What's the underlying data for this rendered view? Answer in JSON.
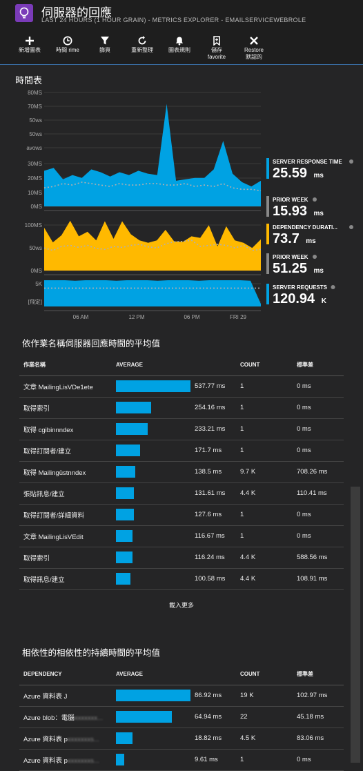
{
  "header": {
    "title": "伺服器的回應",
    "subtitle": "LAST 24 HOURS (1 HOUR GRAIN) - METRICS EXPLORER - EMAILSERVICEWEBROLE"
  },
  "toolbar": {
    "items": [
      {
        "label": "新增圖表",
        "icon": "plus-icon"
      },
      {
        "label": "時間 rime",
        "icon": "clock-icon"
      },
      {
        "label": "篩頁",
        "icon": "filter-icon"
      },
      {
        "label": "重新整理",
        "icon": "refresh-icon"
      },
      {
        "label": "圖表規則",
        "icon": "bell-icon"
      },
      {
        "label1": "儲存",
        "label2": "favorite",
        "icon": "bookmark-icon"
      },
      {
        "label1": "Restore",
        "label2": "默認的",
        "icon": "close-icon"
      }
    ]
  },
  "chart_panel": {
    "title": "時間表",
    "x_ticks": [
      "06 AM",
      "12 PM",
      "06 PM",
      "FRI 29"
    ],
    "metrics": [
      {
        "label": "SERVER RESPONSE TIME",
        "value": "25.59",
        "unit": "ms",
        "color": "#00a2e3"
      },
      {
        "label": "PRIOR WEEK",
        "value": "15.93",
        "unit": "ms",
        "color": "#888888"
      },
      {
        "label": "DEPENDENCY DURATI...",
        "value": "73.7",
        "unit": "ms",
        "color": "#ffb900"
      },
      {
        "label": "PRIOR WEEK",
        "value": "51.25",
        "unit": "ms",
        "color": "#888888"
      },
      {
        "label": "SERVER REQUESTS",
        "value": "120.94",
        "unit": "K",
        "color": "#00a2e3"
      }
    ]
  },
  "chart_data": [
    {
      "type": "area",
      "title": "",
      "ylim": [
        0,
        80
      ],
      "y_ticks": [
        "80MS",
        "70MS",
        "50ws",
        "50ws",
        "avows",
        "30MS",
        "20MS",
        "10MS",
        "0MS"
      ],
      "series": [
        {
          "name": "SERVER RESPONSE TIME",
          "values": [
            25,
            27,
            19,
            22,
            20,
            26,
            24,
            21,
            24,
            22,
            25,
            23,
            22,
            72,
            18,
            19,
            20,
            20,
            26,
            46,
            23,
            17,
            14,
            18
          ]
        },
        {
          "name": "PRIOR WEEK",
          "values": [
            13,
            14,
            16,
            15,
            17,
            16,
            15,
            14,
            16,
            15,
            15,
            16,
            16,
            15,
            15,
            16,
            14,
            15,
            14,
            16,
            13,
            12,
            12,
            11
          ]
        }
      ]
    },
    {
      "type": "area",
      "title": "",
      "ylim": [
        0,
        100
      ],
      "y_ticks": [
        "100MS",
        "50ws",
        "0MS"
      ],
      "series": [
        {
          "name": "DEPENDENCY DURATI...",
          "values": [
            85,
            56,
            70,
            99,
            68,
            77,
            60,
            98,
            63,
            98,
            72,
            60,
            55,
            60,
            81,
            58,
            57,
            68,
            65,
            90,
            48,
            88,
            60,
            55,
            45,
            62
          ]
        },
        {
          "name": "PRIOR WEEK",
          "values": [
            45,
            40,
            48,
            50,
            46,
            50,
            44,
            42,
            48,
            46,
            50,
            52,
            47,
            45,
            53,
            57,
            58,
            60,
            48,
            50,
            52,
            50,
            45,
            50,
            40,
            42
          ]
        }
      ]
    },
    {
      "type": "area",
      "title": "",
      "ylim": [
        0,
        5
      ],
      "y_ticks": [
        "5K",
        "[飛定]"
      ],
      "series": [
        {
          "name": "SERVER REQUESTS",
          "values": [
            5,
            5,
            5,
            4.9,
            5,
            5,
            5,
            4.9,
            5,
            5,
            5,
            4.9,
            5,
            5,
            5,
            4.9,
            5,
            5,
            5,
            5,
            4.9,
            0.5
          ]
        },
        {
          "name": "PRIOR WEEK",
          "values": [
            3.5,
            3.5,
            3.5,
            3.5,
            3.5,
            3.5,
            3.5,
            3.5,
            3.5,
            3.5,
            3.5,
            3.5,
            3.5,
            3.5,
            3.5,
            3.5,
            3.5,
            3.5,
            3.5,
            3.5,
            3.5,
            3.5
          ]
        }
      ]
    }
  ],
  "ops_table": {
    "title": "依作業名稱伺服器回應時間的平均值",
    "headers": [
      "作業名稱",
      "AVERAGE",
      "COUNT",
      "標準差"
    ],
    "more_label": "載入更多",
    "rows": [
      {
        "name": "文章 MailingLisVDe1ete",
        "avg": "537.77 ms",
        "bar": 1.0,
        "count": "1",
        "std": "0 ms"
      },
      {
        "name": "取得索引",
        "avg": "254.16 ms",
        "bar": 0.47,
        "count": "1",
        "std": "0 ms"
      },
      {
        "name": "取得 cgibinnndex",
        "avg": "233.21 ms",
        "bar": 0.43,
        "count": "1",
        "std": "0 ms"
      },
      {
        "name": "取得訂閱者/建立",
        "avg": "171.7 ms",
        "bar": 0.32,
        "count": "1",
        "std": "0 ms"
      },
      {
        "name": "取得 Mailingüstnndex",
        "avg": "138.5 ms",
        "bar": 0.26,
        "count": "9.7 K",
        "std": "708.26 ms"
      },
      {
        "name": "張貼訊息/建立",
        "avg": "131.61 ms",
        "bar": 0.24,
        "count": "4.4 K",
        "std": "110.41 ms"
      },
      {
        "name": "取得訂閱者/詳細資料",
        "avg": "127.6 ms",
        "bar": 0.24,
        "count": "1",
        "std": "0 ms"
      },
      {
        "name": "文章 MailingLisVEdit",
        "avg": "116.67 ms",
        "bar": 0.22,
        "count": "1",
        "std": "0 ms"
      },
      {
        "name": "取得索引",
        "avg": "116.24 ms",
        "bar": 0.22,
        "count": "4.4 K",
        "std": "588.56 ms"
      },
      {
        "name": "取得訊息/建立",
        "avg": "100.58 ms",
        "bar": 0.19,
        "count": "4.4 K",
        "std": "108.91 ms"
      }
    ]
  },
  "dep_table": {
    "title": "相依性的相依性的持續時間的平均值",
    "headers": [
      "DEPENDENCY",
      "AVERAGE",
      "COUNT",
      "標準差"
    ],
    "rows": [
      {
        "name": "Azure 資料表 J",
        "blur": "",
        "avg": "86.92 ms",
        "bar": 1.0,
        "count": "19 K",
        "std": "102.97 ms"
      },
      {
        "name": "Azure blob：電腦",
        "blur": "xxxxxxx...",
        "avg": "64.94 ms",
        "bar": 0.75,
        "count": "22",
        "std": "45.18 ms"
      },
      {
        "name": "Azure 資料表 p",
        "blur": "xxxxxxxs...",
        "avg": "18.82 ms",
        "bar": 0.22,
        "count": "4.5 K",
        "std": "83.06 ms"
      },
      {
        "name": "Azure 資料表 p",
        "blur": "xxxxxxxs...",
        "avg": "9.61 ms",
        "bar": 0.11,
        "count": "1",
        "std": "0 ms"
      }
    ]
  }
}
